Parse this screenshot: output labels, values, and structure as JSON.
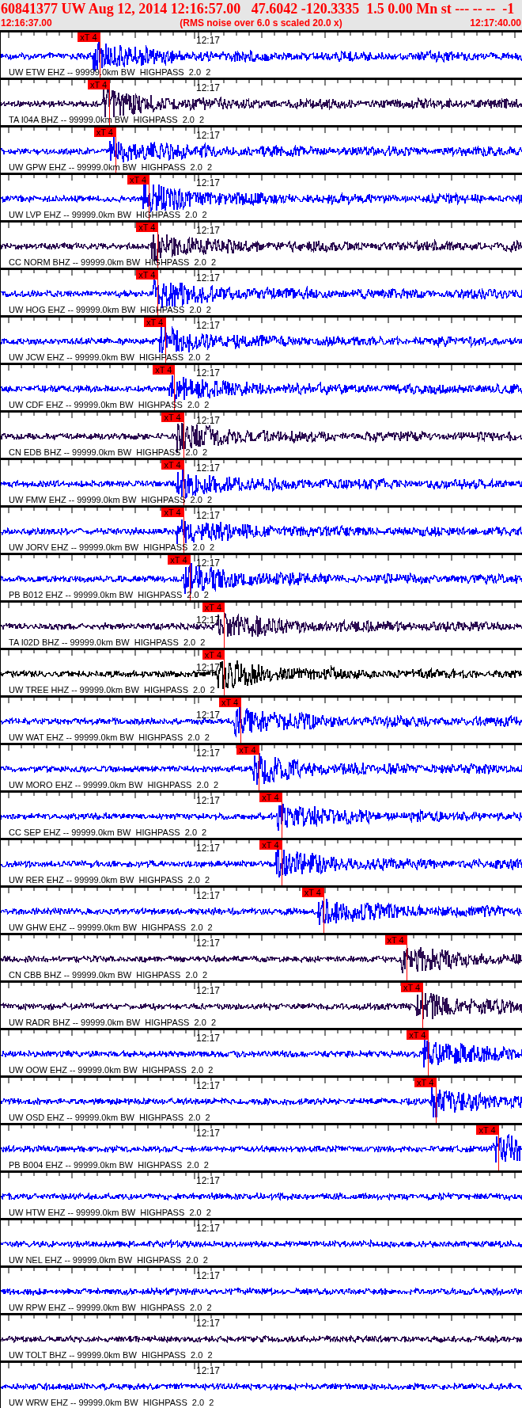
{
  "header": {
    "title": "60841377 UW Aug 12, 2014 12:16:57.00   47.6042 -120.3335  1.5 0.00 Mn st --- -- --  -1",
    "start_time": "12:16:37.00",
    "note": "(RMS noise over 6.0 s scaled 20.0 x)",
    "end_time": "12:17:40.00"
  },
  "traces": [
    {
      "label": "UW ETW EHZ -- 99999.0km BW  HIGHPASS  2.0  2",
      "time_label": "12:17",
      "color": "#0000ff",
      "pick": {
        "label": "xT 4",
        "level": 0.189
      }
    },
    {
      "label": "TA I04A BHZ -- 99999.0km BW  HIGHPASS  2.0  2",
      "time_label": "12:17",
      "color": "#2a0a50",
      "pick": {
        "label": "xT 4",
        "level": 0.208
      }
    },
    {
      "label": "UW GPW EHZ -- 99999.0km BW  HIGHPASS  2.0  2",
      "time_label": "12:17",
      "color": "#0000ff",
      "pick": {
        "label": "xT 4",
        "level": 0.22
      }
    },
    {
      "label": "UW LVP EHZ -- 99999.0km BW  HIGHPASS  2.0  2",
      "time_label": "12:17",
      "color": "#0000ff",
      "pick": {
        "label": "xT 4",
        "level": 0.284
      }
    },
    {
      "label": "CC NORM BHZ -- 99999.0km BW  HIGHPASS  2.0  2",
      "time_label": "12:17",
      "color": "#2a0a50",
      "pick": {
        "label": "xT 4",
        "level": 0.301
      }
    },
    {
      "label": "UW HOG EHZ -- 99999.0km BW  HIGHPASS  2.0  2",
      "time_label": "12:17",
      "color": "#0000ff",
      "pick": {
        "label": "xT 4",
        "level": 0.301
      }
    },
    {
      "label": "UW JCW EHZ -- 99999.0km BW  HIGHPASS  2.0  2",
      "time_label": "12:17",
      "color": "#0000ff",
      "pick": {
        "label": "xT 4",
        "level": 0.316
      }
    },
    {
      "label": "UW CDF EHZ -- 99999.0km BW  HIGHPASS  2.0  2",
      "time_label": "12:17",
      "color": "#0000ff",
      "pick": {
        "label": "xT 4",
        "level": 0.333
      }
    },
    {
      "label": "CN EDB BHZ -- 99999.0km BW  HIGHPASS  2.0  2",
      "time_label": "12:17",
      "color": "#2a0a50",
      "pick": {
        "label": "xT 4",
        "level": 0.35
      }
    },
    {
      "label": "UW FMW EHZ -- 99999.0km BW  HIGHPASS  2.0  2",
      "time_label": "12:17",
      "color": "#0000ff",
      "pick": {
        "label": "xT 4",
        "level": 0.35
      }
    },
    {
      "label": "UW JORV EHZ -- 99999.0km BW  HIGHPASS  2.0  2",
      "time_label": "12:17",
      "color": "#0000ff",
      "pick": {
        "label": "xT 4",
        "level": 0.35
      }
    },
    {
      "label": "PB B012 EHZ -- 99999.0km BW  HIGHPASS  2.0  2",
      "time_label": "12:17",
      "color": "#0000ff",
      "pick": {
        "label": "xT 4",
        "level": 0.362
      }
    },
    {
      "label": "TA I02D BHZ -- 99999.0km BW  HIGHPASS  2.0  2",
      "time_label": "12:17",
      "color": "#2a0a50",
      "pick": {
        "label": "xT 4",
        "level": 0.428
      }
    },
    {
      "label": "UW TREE HHZ -- 99999.0km BW  HIGHPASS  2.0  2",
      "time_label": "12:17",
      "color": "#000000",
      "pick": {
        "label": "xT 4",
        "level": 0.428
      }
    },
    {
      "label": "UW WAT EHZ -- 99999.0km BW  HIGHPASS  2.0  2",
      "time_label": "12:17",
      "color": "#0000ff",
      "pick": {
        "label": "xT 4",
        "level": 0.46
      }
    },
    {
      "label": "UW MORO EHZ -- 99999.0km BW  HIGHPASS  2.0  2",
      "time_label": "12:17",
      "color": "#0000ff",
      "pick": {
        "label": "xT 4",
        "level": 0.494
      }
    },
    {
      "label": "CC SEP EHZ -- 99999.0km BW  HIGHPASS  2.0  2",
      "time_label": "12:17",
      "color": "#0000ff",
      "pick": {
        "label": "xT 4",
        "level": 0.538
      }
    },
    {
      "label": "UW RER EHZ -- 99999.0km BW  HIGHPASS  2.0  2",
      "time_label": "12:17",
      "color": "#0000ff",
      "pick": {
        "label": "xT 4",
        "level": 0.538
      }
    },
    {
      "label": "UW GHW EHZ -- 99999.0km BW  HIGHPASS  2.0  2",
      "time_label": "12:17",
      "color": "#0000ff",
      "pick": {
        "label": "xT 4",
        "level": 0.619
      }
    },
    {
      "label": "CN CBB BHZ -- 99999.0km BW  HIGHPASS  2.0  2",
      "time_label": "12:17",
      "color": "#2a0a50",
      "pick": {
        "label": "xT 4",
        "level": 0.778
      }
    },
    {
      "label": "UW RADR BHZ -- 99999.0km BW  HIGHPASS  2.0  2",
      "time_label": "12:17",
      "color": "#2a0a50",
      "pick": {
        "label": "xT 4",
        "level": 0.809
      }
    },
    {
      "label": "UW OOW EHZ -- 99999.0km BW  HIGHPASS  2.0  2",
      "time_label": "12:17",
      "color": "#0000ff",
      "pick": {
        "label": "xT 4",
        "level": 0.82
      }
    },
    {
      "label": "UW OSD EHZ -- 99999.0km BW  HIGHPASS  2.0  2",
      "time_label": "12:17",
      "color": "#0000ff",
      "pick": {
        "label": "xT 4",
        "level": 0.835
      }
    },
    {
      "label": "PB B004 EHZ -- 99999.0km BW  HIGHPASS  2.0  2",
      "time_label": "12:17",
      "color": "#0000ff",
      "pick": {
        "label": "xT 4",
        "level": 0.954
      }
    },
    {
      "label": "UW HTW EHZ -- 99999.0km BW  HIGHPASS  2.0  2",
      "time_label": "12:17",
      "color": "#0000ff"
    },
    {
      "label": "UW NEL EHZ -- 99999.0km BW  HIGHPASS  2.0  2",
      "time_label": "12:17",
      "color": "#0000ff"
    },
    {
      "label": "UW RPW EHZ -- 99999.0km BW  HIGHPASS  2.0  2",
      "time_label": "12:17",
      "color": "#0000ff"
    },
    {
      "label": "UW TOLT BHZ -- 99999.0km BW  HIGHPASS  2.0  2",
      "time_label": "12:17",
      "color": "#2a0a50"
    },
    {
      "label": "UW WRW EHZ -- 99999.0km BW  HIGHPASS  2.0  2",
      "time_label": "12:17",
      "color": "#0000ff"
    }
  ]
}
